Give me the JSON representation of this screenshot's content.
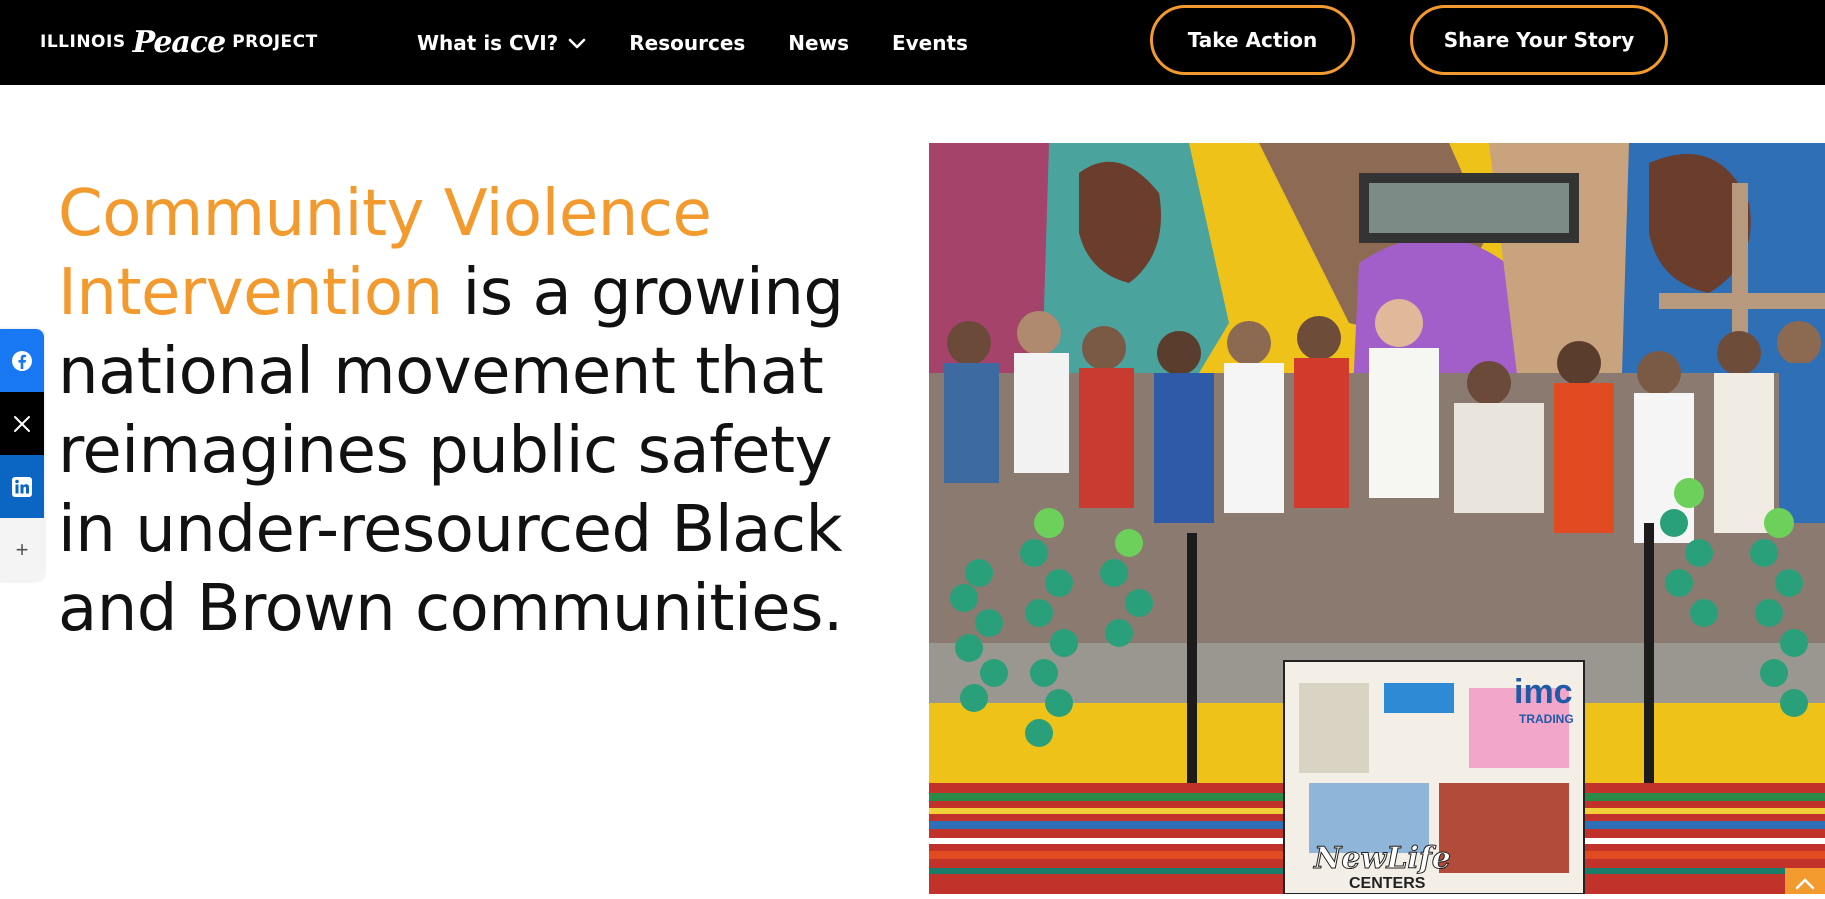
{
  "brand": {
    "logo_left": "ILLINOIS",
    "logo_mid": "Peace",
    "logo_right": "PROJECT"
  },
  "nav": {
    "items": [
      {
        "label": "What is CVI?",
        "has_dropdown": true
      },
      {
        "label": "Resources"
      },
      {
        "label": "News"
      },
      {
        "label": "Events"
      }
    ]
  },
  "cta": {
    "take_action": "Take Action",
    "share_story": "Share Your Story"
  },
  "share": {
    "icons": [
      "facebook-icon",
      "x-icon",
      "linkedin-icon",
      "plus-icon"
    ],
    "more_label": "+"
  },
  "hero": {
    "accent_text": "Community Violence Intervention",
    "rest_text": " is a growing national movement that reimagines public safety in under-resourced Black and Brown communities."
  },
  "photo": {
    "podium_sign": "imc",
    "podium_sign_sub": "TRADING",
    "collage_text": "NewLife",
    "collage_sub": "CENTERS"
  },
  "colors": {
    "accent": "#f39a2e",
    "header_bg": "#000000",
    "facebook": "#1877f2",
    "linkedin": "#0a66c2"
  }
}
